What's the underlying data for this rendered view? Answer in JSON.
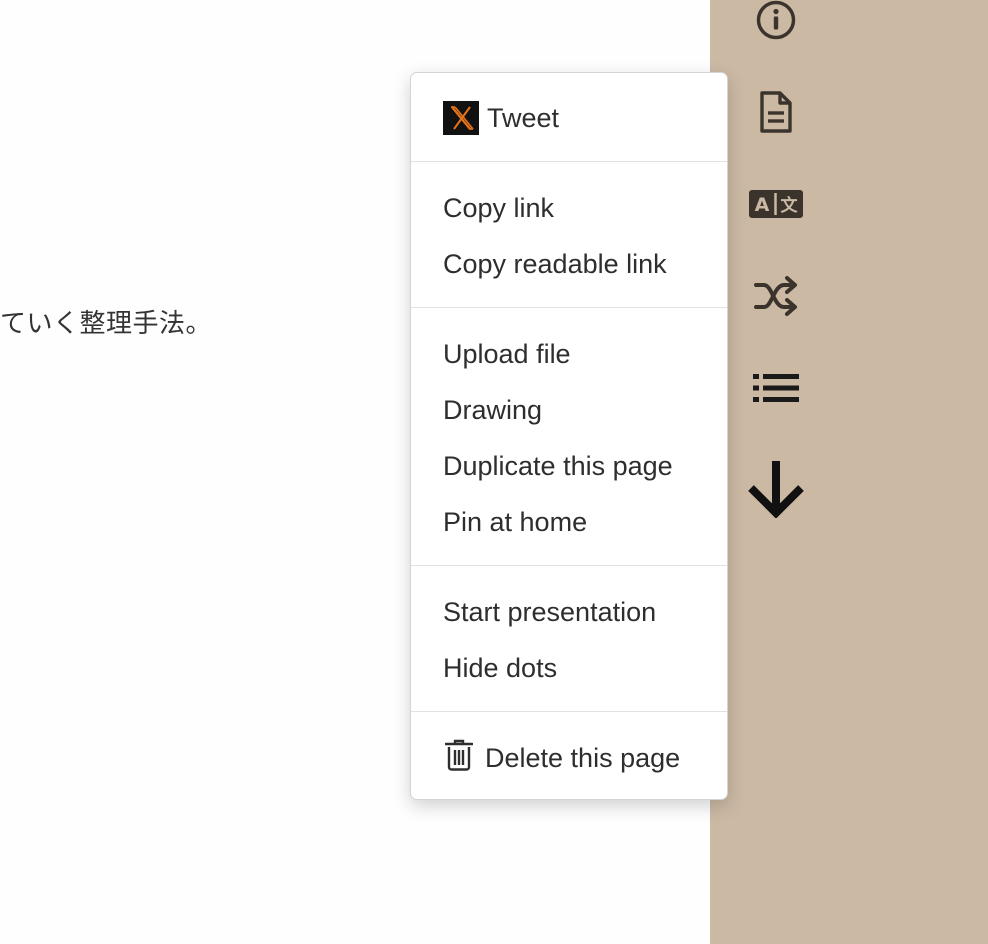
{
  "page": {
    "body_text": "ていく整理手法。"
  },
  "menu": {
    "tweet": {
      "label": "Tweet",
      "icon": "x-logo-icon"
    },
    "copy_link": "Copy link",
    "copy_readable_link": "Copy readable link",
    "upload_file": "Upload file",
    "drawing": "Drawing",
    "duplicate_page": "Duplicate this page",
    "pin_at_home": "Pin at home",
    "start_presentation": "Start presentation",
    "hide_dots": "Hide dots",
    "delete_page": {
      "label": "Delete this page",
      "icon": "trash-icon"
    }
  },
  "sidebar": {
    "icons": [
      "info-icon",
      "document-icon",
      "translate-icon",
      "shuffle-icon",
      "list-icon",
      "arrow-down-icon"
    ]
  },
  "colors": {
    "sidebar_bg": "#cbb9a4",
    "icon": "#3b342d",
    "x_logo_accent": "#e8731a"
  }
}
